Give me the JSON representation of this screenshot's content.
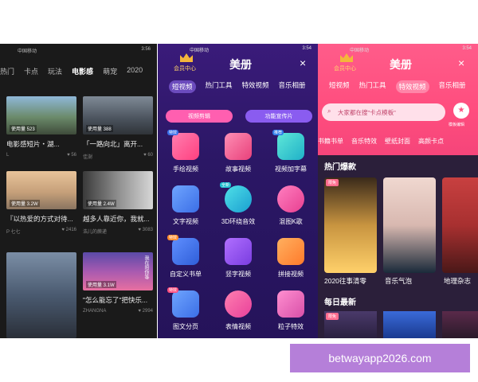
{
  "panel1": {
    "status": {
      "left": "中国移动",
      "right": "3:56"
    },
    "tabs": [
      "热门",
      "卡点",
      "玩法",
      "电影感",
      "萌宠",
      "2020"
    ],
    "active_tab": "电影感",
    "cards": [
      {
        "title": "电影感短片・湖...",
        "badge": "使用量 523",
        "user": "L",
        "likes": "56"
      },
      {
        "title": "「一路向北」离开...",
        "badge": "使用量 388",
        "user": "佳澍",
        "likes": "60"
      },
      {
        "title": "『以热爱的方式对待...",
        "badge": "使用量 3.2W",
        "user": "P 七七",
        "likes": "2416"
      },
      {
        "title": "越多人靠近你，我就...",
        "badge": "使用量 2.4W",
        "user": "浩儿的蕨递",
        "likes": "3083"
      },
      {
        "title": "",
        "badge": "",
        "user": "",
        "likes": ""
      },
      {
        "title": "\"怎么能忘了\"把快乐...",
        "badge": "使用量 3.1W",
        "user": "ZHANGNA",
        "likes": "2994"
      }
    ],
    "vertical_text": "我在陪你等"
  },
  "panel2": {
    "status": {
      "left": "中国移动",
      "right": "3:54"
    },
    "vip_label": "会员中心",
    "app_title": "美册",
    "close_icon": "×",
    "tabs": [
      "短视频",
      "热门工具",
      "特效视频",
      "音乐相册"
    ],
    "active_tab": "短视频",
    "pills": [
      "视频剪辑",
      "功能宣传片"
    ],
    "tools": [
      {
        "label": "手绘视频",
        "tag": "特效",
        "color": "#ff4f93"
      },
      {
        "label": "故事视频",
        "tag": "",
        "color": "#ff5f8f"
      },
      {
        "label": "视频加字幕",
        "tag": "推荐",
        "color": "#2fd4c6"
      },
      {
        "label": "文字视频",
        "tag": "",
        "color": "#3b7ae8"
      },
      {
        "label": "3D环绕音效",
        "tag": "全新",
        "color": "#1fbfcf"
      },
      {
        "label": "混图K歌",
        "tag": "",
        "color": "#ff4fa0"
      },
      {
        "label": "自定义书单",
        "tag": "特效",
        "color": "#3b6ee6"
      },
      {
        "label": "竖字视频",
        "tag": "",
        "color": "#8a3de8"
      },
      {
        "label": "拼接视频",
        "tag": "",
        "color": "#ff8a2b"
      },
      {
        "label": "图文分页",
        "tag": "特效",
        "color": "#3b7ae8"
      },
      {
        "label": "表情视频",
        "tag": "",
        "color": "#e8409a"
      },
      {
        "label": "粒子特效",
        "tag": "",
        "color": "#ff5fa8"
      }
    ]
  },
  "panel3": {
    "status": {
      "left": "中国移动",
      "right": "3:54"
    },
    "vip_label": "会员中心",
    "app_title": "美册",
    "close_icon": "×",
    "tabs": [
      "短视频",
      "热门工具",
      "特效视频",
      "音乐相册"
    ],
    "active_tab": "特效视频",
    "search_placeholder": "大家都在搜\"卡点模板\"",
    "template_btn": "模板编辑",
    "categories": [
      "书籍书单",
      "音乐特效",
      "壁纸封面",
      "高颜卡点"
    ],
    "hot_title": "热门爆款",
    "hot_items": [
      {
        "label": "2020往事清零",
        "badge": "限免"
      },
      {
        "label": "音乐气泡",
        "badge": ""
      },
      {
        "label": "地理杂志",
        "badge": ""
      }
    ],
    "daily_title": "每日最新",
    "daily_badge": "限免"
  },
  "watermark": "betwayapp2026.com"
}
